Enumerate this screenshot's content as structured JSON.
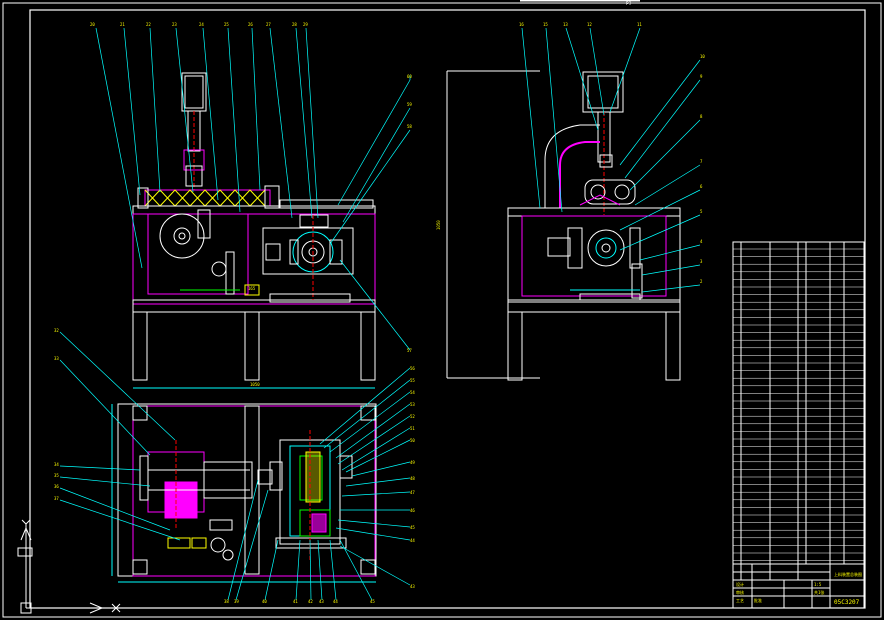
{
  "colors": {
    "background": "#000000",
    "white": "#ffffff",
    "cyan": "#00ffff",
    "magenta": "#ff00ff",
    "yellow": "#ffff00",
    "red": "#ff0000",
    "green": "#00ff00"
  },
  "drawing": {
    "top_note": "pj",
    "title_block": {
      "drawing_name": "上料装置总装图",
      "drawing_number": "05C3207",
      "scale": "1:5",
      "sheet": "共1张",
      "approval_rows": [
        "设计",
        "审核",
        "工艺",
        "批准"
      ]
    },
    "icons": [
      "ucs-axis-icon"
    ]
  }
}
